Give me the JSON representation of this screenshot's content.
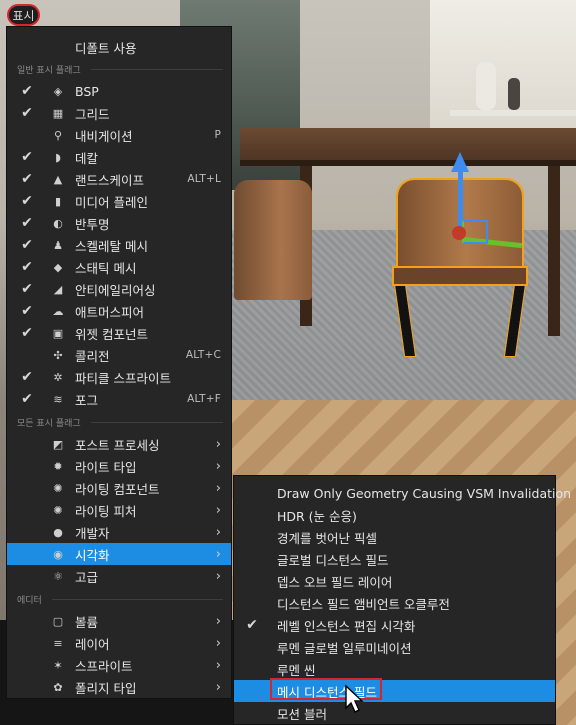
{
  "toolbar": {
    "show_label": "표시"
  },
  "menu": {
    "default_label": "디폴트 사용",
    "section_general": "일반 표시 플래그",
    "section_all": "모든 표시 플래그",
    "section_editor": "에디터",
    "general_items": [
      {
        "label": "BSP",
        "checked": true,
        "shortcut": "",
        "icon": "cube-icon"
      },
      {
        "label": "그리드",
        "checked": true,
        "shortcut": "",
        "icon": "grid-icon"
      },
      {
        "label": "내비게이션",
        "checked": false,
        "shortcut": "P",
        "icon": "pin-icon"
      },
      {
        "label": "데칼",
        "checked": true,
        "shortcut": "",
        "icon": "decal-icon"
      },
      {
        "label": "랜드스케이프",
        "checked": true,
        "shortcut": "ALT+L",
        "icon": "mountain-icon"
      },
      {
        "label": "미디어 플레인",
        "checked": true,
        "shortcut": "",
        "icon": "media-plane-icon"
      },
      {
        "label": "반투명",
        "checked": true,
        "shortcut": "",
        "icon": "translucency-icon"
      },
      {
        "label": "스켈레탈 메시",
        "checked": true,
        "shortcut": "",
        "icon": "skeleton-icon"
      },
      {
        "label": "스태틱 메시",
        "checked": true,
        "shortcut": "",
        "icon": "static-mesh-icon"
      },
      {
        "label": "안티에일리어싱",
        "checked": true,
        "shortcut": "",
        "icon": "antialias-icon"
      },
      {
        "label": "애트머스피어",
        "checked": true,
        "shortcut": "",
        "icon": "atmosphere-icon"
      },
      {
        "label": "위젯 컴포넌트",
        "checked": true,
        "shortcut": "",
        "icon": "widget-icon"
      },
      {
        "label": "콜리전",
        "checked": false,
        "shortcut": "ALT+C",
        "icon": "collision-icon"
      },
      {
        "label": "파티클 스프라이트",
        "checked": true,
        "shortcut": "",
        "icon": "particle-icon"
      },
      {
        "label": "포그",
        "checked": true,
        "shortcut": "ALT+F",
        "icon": "fog-icon"
      }
    ],
    "all_items": [
      {
        "label": "포스트 프로세싱",
        "icon": "postprocess-icon"
      },
      {
        "label": "라이트 타입",
        "icon": "light-type-icon"
      },
      {
        "label": "라이팅 컴포넌트",
        "icon": "lighting-component-icon"
      },
      {
        "label": "라이팅 피처",
        "icon": "lighting-feature-icon"
      },
      {
        "label": "개발자",
        "icon": "developer-icon"
      },
      {
        "label": "시각화",
        "icon": "visualize-icon",
        "highlighted": true
      },
      {
        "label": "고급",
        "icon": "advanced-icon"
      }
    ],
    "editor_items": [
      {
        "label": "볼륨",
        "icon": "volume-icon"
      },
      {
        "label": "레이어",
        "icon": "layers-icon"
      },
      {
        "label": "스프라이트",
        "icon": "sprite-icon"
      },
      {
        "label": "폴리지 타입",
        "icon": "foliage-icon"
      }
    ]
  },
  "submenu": {
    "items": [
      {
        "label": "Draw Only Geometry Causing VSM Invalidation",
        "checked": false
      },
      {
        "label": "HDR (눈 순응)",
        "checked": false
      },
      {
        "label": "경계를 벗어난 픽셀",
        "checked": false
      },
      {
        "label": "글로벌 디스턴스 필드",
        "checked": false
      },
      {
        "label": "뎁스 오브 필드 레이어",
        "checked": false
      },
      {
        "label": "디스턴스 필드 앰비언트 오클루전",
        "checked": false
      },
      {
        "label": "레벨 인스턴스 편집 시각화",
        "checked": true
      },
      {
        "label": "루멘 글로벌 일루미네이션",
        "checked": false
      },
      {
        "label": "루멘 씬",
        "checked": false
      },
      {
        "label": "메시 디스턴스 필드",
        "checked": false,
        "highlighted": true
      },
      {
        "label": "모션 블러",
        "checked": false
      }
    ]
  },
  "colors": {
    "accent": "#1d8de3",
    "menu_bg": "#262626",
    "annotation": "#d6262b"
  }
}
